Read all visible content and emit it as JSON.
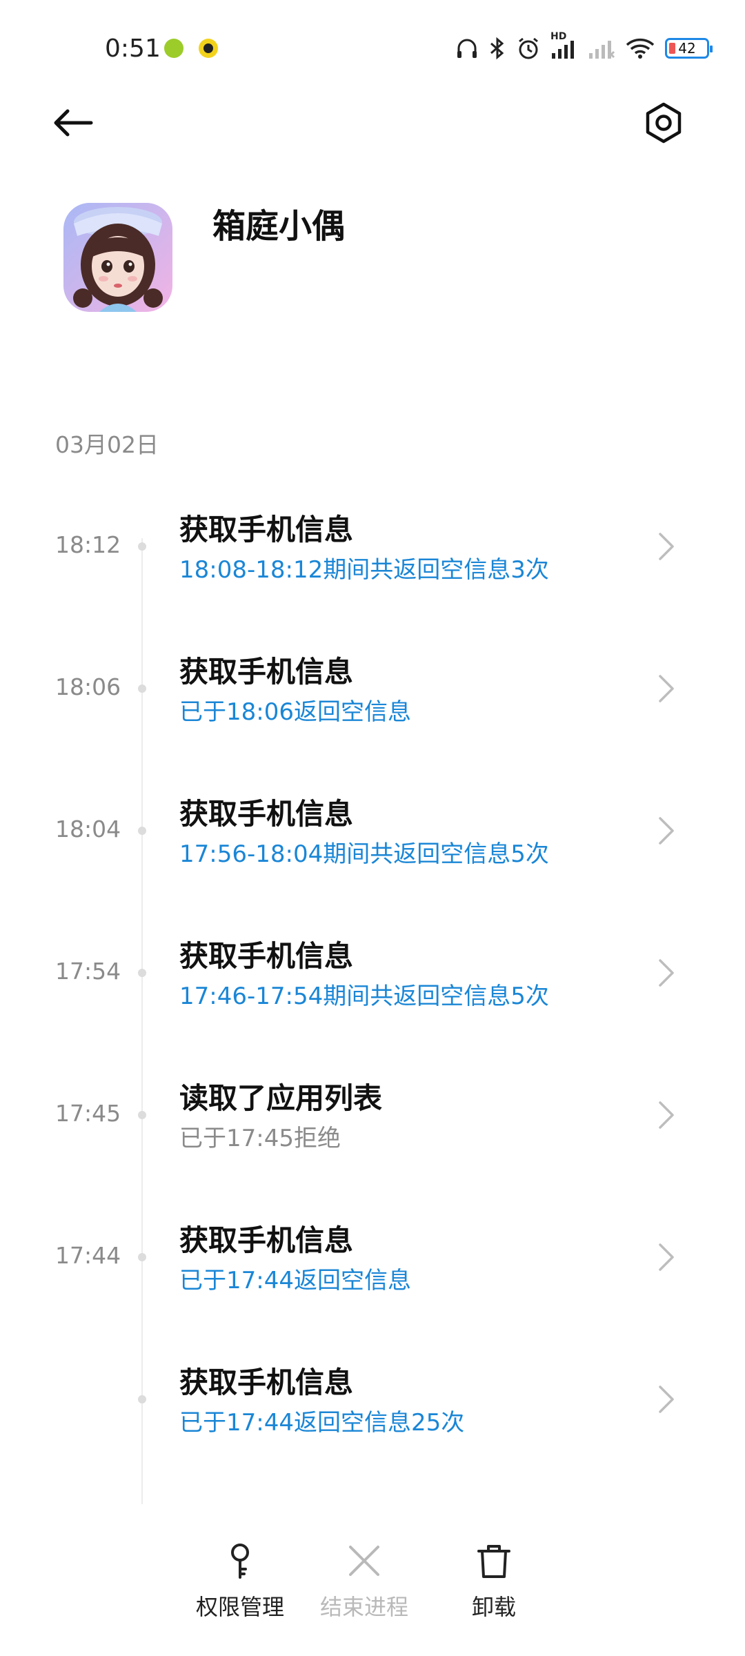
{
  "status_bar": {
    "time": "0:51",
    "battery": "42",
    "hd_label": "HD",
    "icons": [
      "headphone-icon",
      "bluetooth-icon",
      "alarm-icon",
      "signal-hd-icon",
      "signal-icon",
      "wifi-icon",
      "battery-icon"
    ]
  },
  "header": {
    "back_icon": "arrow-left-icon",
    "settings_icon": "hexagon-settings-icon"
  },
  "app": {
    "name": "箱庭小偶"
  },
  "date": "03月02日",
  "records": [
    {
      "time": "18:12",
      "title": "获取手机信息",
      "detail": "18:08-18:12期间共返回空信息3次",
      "detail_color": "blue"
    },
    {
      "time": "18:06",
      "title": "获取手机信息",
      "detail": "已于18:06返回空信息",
      "detail_color": "blue"
    },
    {
      "time": "18:04",
      "title": "获取手机信息",
      "detail": "17:56-18:04期间共返回空信息5次",
      "detail_color": "blue"
    },
    {
      "time": "17:54",
      "title": "获取手机信息",
      "detail": "17:46-17:54期间共返回空信息5次",
      "detail_color": "blue"
    },
    {
      "time": "17:45",
      "title": "读取了应用列表",
      "detail": "已于17:45拒绝",
      "detail_color": "gray"
    },
    {
      "time": "17:44",
      "title": "获取手机信息",
      "detail": "已于17:44返回空信息",
      "detail_color": "blue"
    },
    {
      "time": "",
      "title": "获取手机信息",
      "detail": "已于17:44返回空信息25次",
      "detail_color": "blue"
    }
  ],
  "bottom_bar": {
    "permissions": "权限管理",
    "end_process": "结束进程",
    "uninstall": "卸载"
  },
  "colors": {
    "accent": "#1a86d6",
    "muted": "#8a8a8a",
    "disabled": "#b9b9b9"
  }
}
